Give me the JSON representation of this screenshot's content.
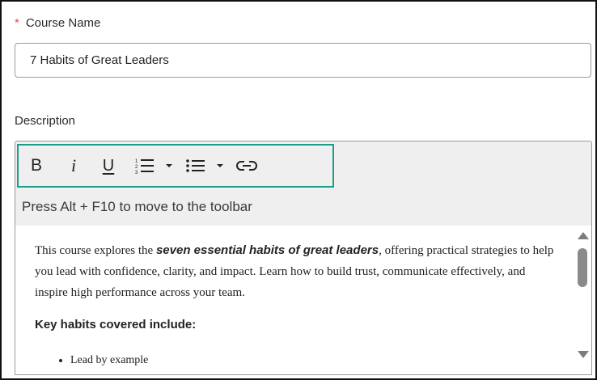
{
  "course_name": {
    "required_marker": "*",
    "label": "Course Name",
    "value": "7 Habits of Great Leaders"
  },
  "description": {
    "label": "Description",
    "toolbar": {
      "bold_label": "B",
      "italic_label": "i",
      "underline_label": "U",
      "icons": [
        "bold-icon",
        "italic-icon",
        "underline-icon",
        "numbered-list-icon",
        "chevron-down-icon",
        "bulleted-list-icon",
        "chevron-down-icon",
        "link-icon"
      ]
    },
    "hint": "Press Alt + F10 to move to the toolbar",
    "content": {
      "para_before": "This course explores the ",
      "para_bold": "seven essential habits of great leaders",
      "para_after": ", offering practical strategies to help you lead with confidence, clarity, and impact. Learn how to build trust, communicate effectively, and inspire high performance across your team.",
      "key_heading": "Key habits covered include:",
      "list_items": [
        "Lead by example"
      ]
    }
  },
  "colors": {
    "toolbar_focus_border": "#1a9e8a",
    "required_star": "#d9534f",
    "editor_background": "#efefef"
  }
}
